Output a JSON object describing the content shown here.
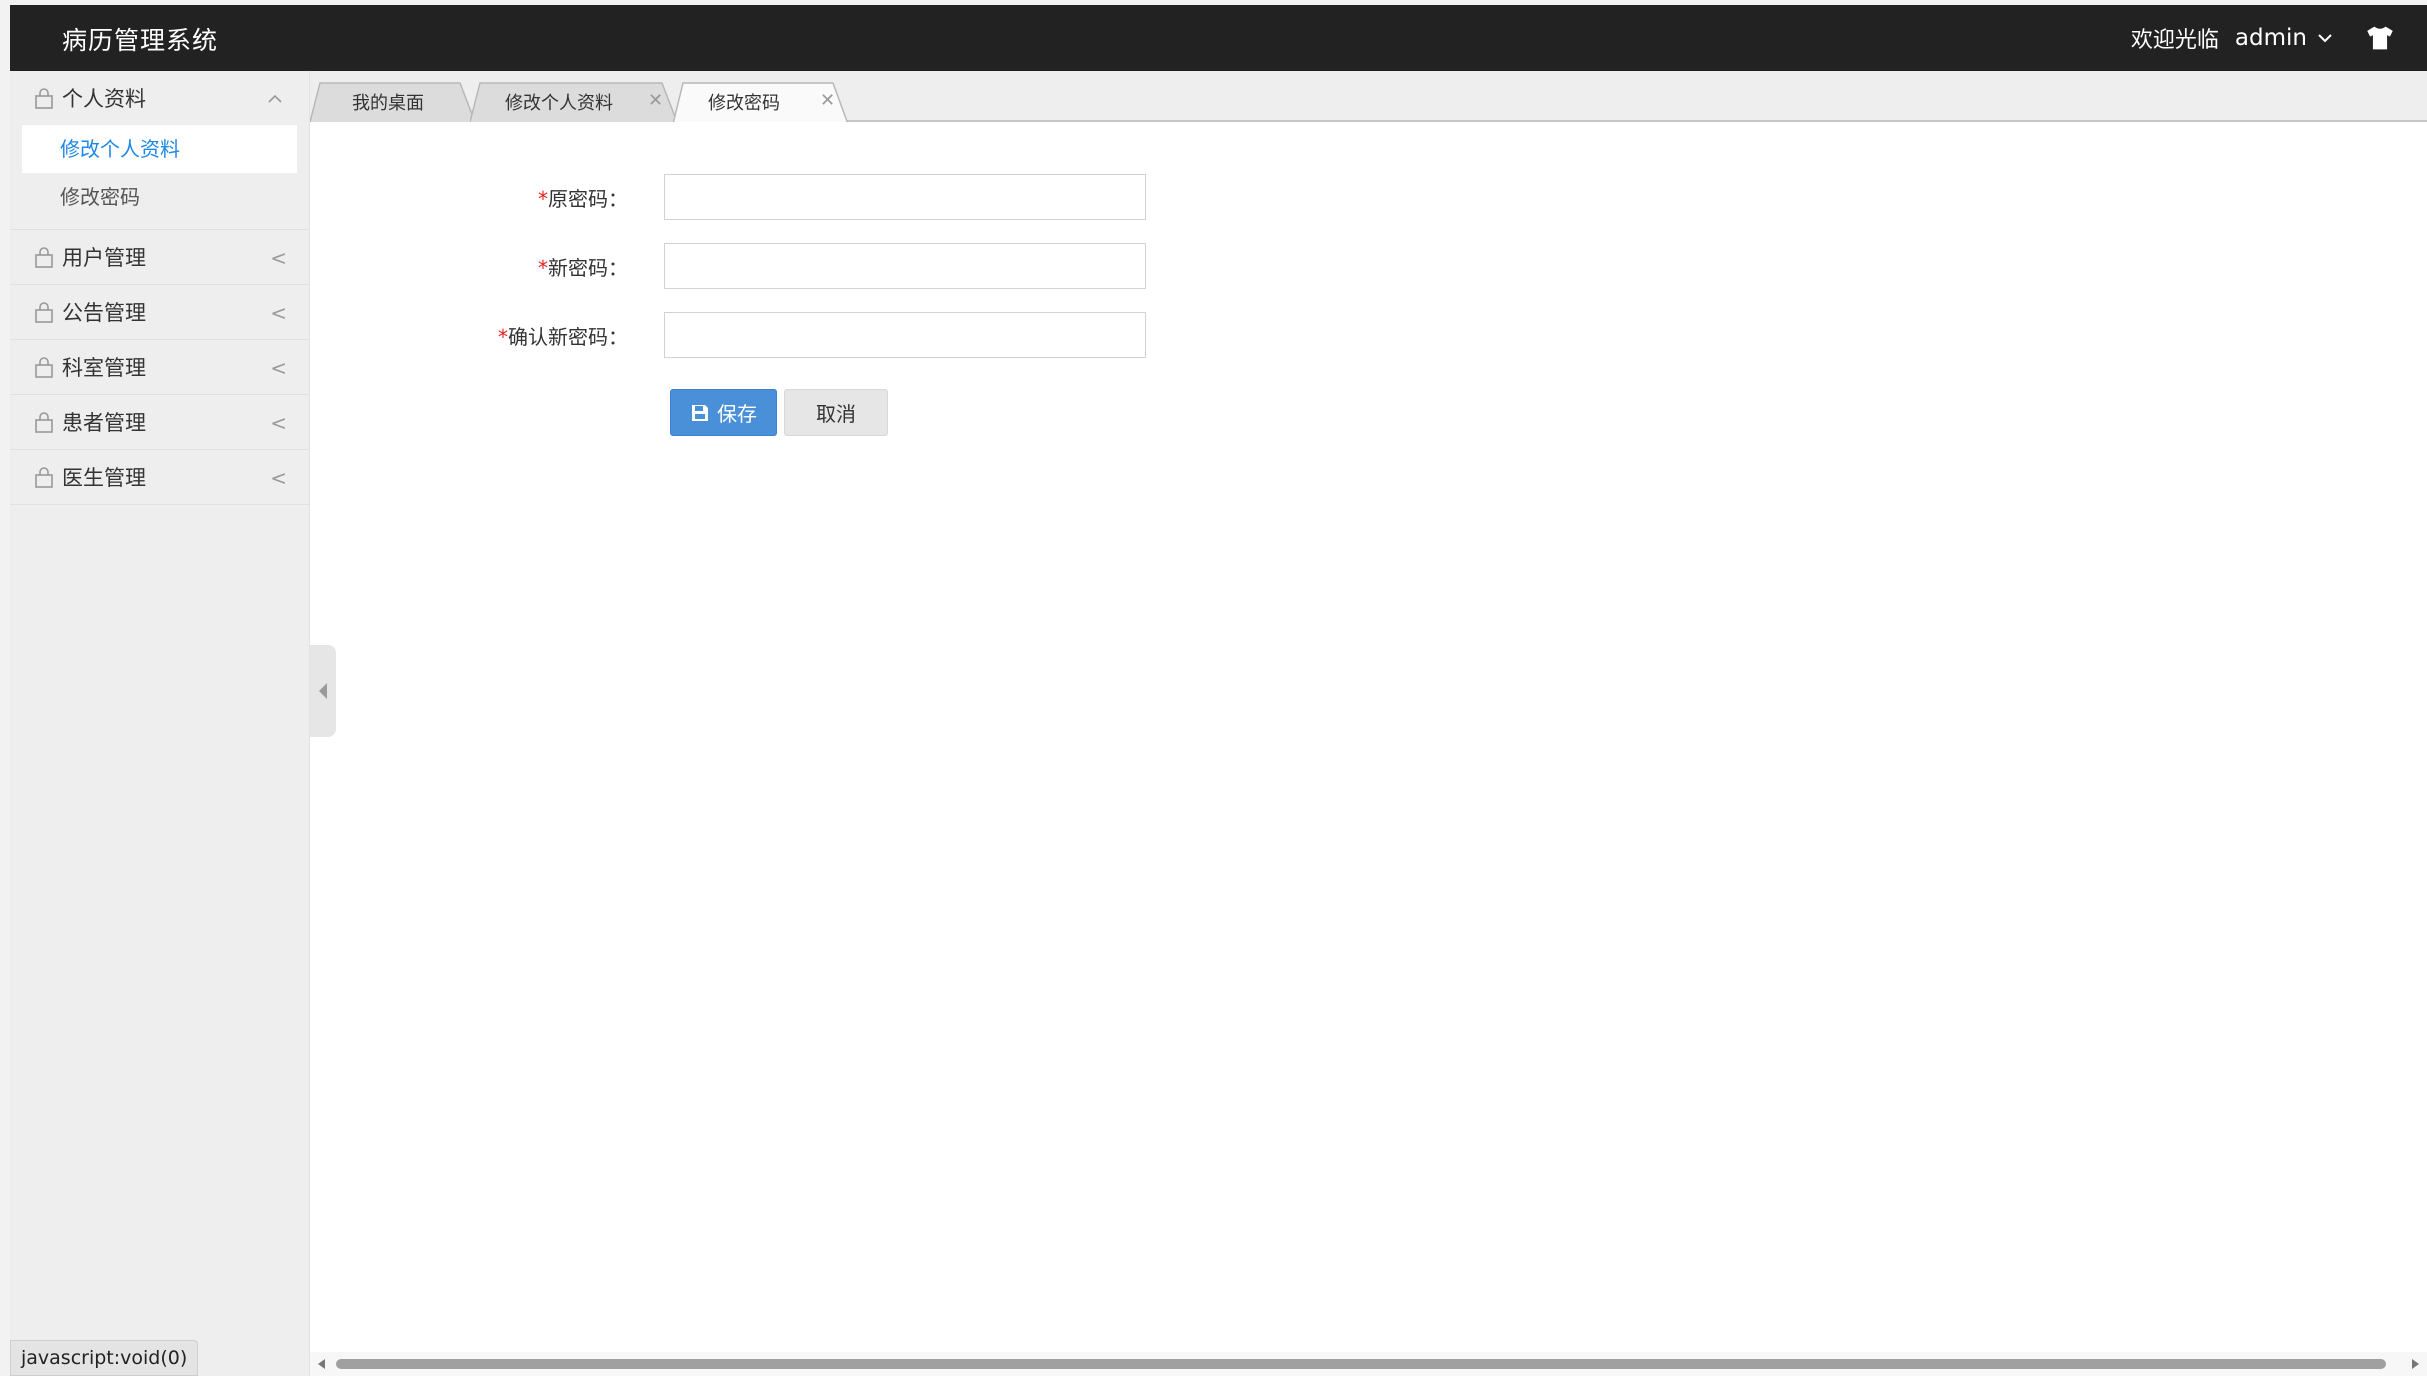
{
  "header": {
    "app_title": "病历管理系统",
    "welcome_text": "欢迎光临",
    "username": "admin"
  },
  "sidebar": {
    "groups": [
      {
        "label": "个人资料",
        "expanded": true,
        "items": [
          {
            "label": "修改个人资料",
            "active": true
          },
          {
            "label": "修改密码",
            "active": false
          }
        ]
      },
      {
        "label": "用户管理",
        "expanded": false
      },
      {
        "label": "公告管理",
        "expanded": false
      },
      {
        "label": "科室管理",
        "expanded": false
      },
      {
        "label": "患者管理",
        "expanded": false
      },
      {
        "label": "医生管理",
        "expanded": false
      }
    ],
    "collapsed_arrow": "<"
  },
  "tabs": [
    {
      "label": "我的桌面",
      "closable": false,
      "active": false
    },
    {
      "label": "修改个人资料",
      "closable": true,
      "active": false
    },
    {
      "label": "修改密码",
      "closable": true,
      "active": true
    }
  ],
  "form": {
    "required_mark": "*",
    "fields": [
      {
        "label": "原密码：",
        "value": ""
      },
      {
        "label": "新密码：",
        "value": ""
      },
      {
        "label": "确认新密码：",
        "value": ""
      }
    ],
    "save_label": "保存",
    "cancel_label": "取消"
  },
  "status_bar": {
    "text": "javascript:void(0)"
  },
  "colors": {
    "header_bg": "#222222",
    "accent": "#1e88e5",
    "save_button": "#4a90d9",
    "required": "#e3231a"
  },
  "icons": [
    "chevron-down-icon",
    "skin-icon",
    "lock-icon",
    "chevron-up-icon",
    "close-icon",
    "save-icon",
    "collapse-left-icon"
  ]
}
